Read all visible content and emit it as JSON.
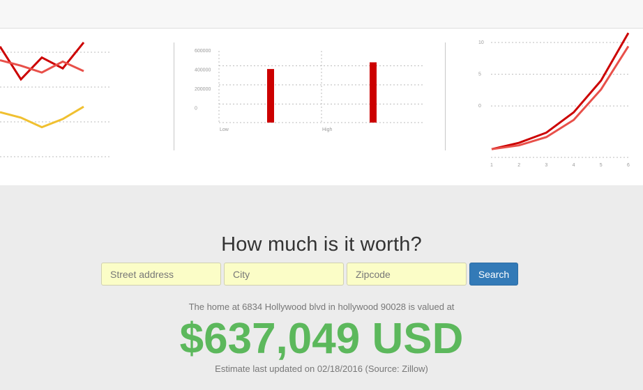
{
  "page": {
    "headline": "How much is it worth?",
    "search": {
      "street_placeholder": "Street address",
      "city_placeholder": "City",
      "zip_placeholder": "Zipcode",
      "button_label": "Search"
    },
    "result": {
      "valued_text": "The home at 6834 Hollywood blvd in hollywood 90028 is valued at",
      "price": "$637,049 USD",
      "updated_text": "Estimate last updated on 02/18/2016 (Source: Zillow)"
    }
  },
  "chart_data": [
    {
      "type": "line",
      "x": [
        1,
        2,
        3,
        4,
        5
      ],
      "ylim": [
        0,
        8
      ],
      "series": [
        {
          "values": [
            7.6,
            5.2,
            6.8,
            6.0,
            7.9
          ],
          "color": "#cc0000"
        },
        {
          "values": [
            6.6,
            6.2,
            5.7,
            6.5,
            5.8
          ],
          "color": "#e8504a"
        },
        {
          "values": [
            2.8,
            2.4,
            1.7,
            2.3,
            3.2
          ],
          "color": "#f0c030"
        }
      ]
    },
    {
      "type": "bar",
      "categories": [
        "Low",
        "High"
      ],
      "values": [
        410000,
        480000
      ],
      "y_ticks": [
        "600000",
        "400000",
        "200000",
        "0"
      ],
      "ylim": [
        -150000,
        600000
      ],
      "color": "#cc0000",
      "grid": true
    },
    {
      "type": "line",
      "x": [
        1,
        2,
        3,
        4,
        5,
        6
      ],
      "x_ticks": [
        "1",
        "2",
        "3",
        "4",
        "5",
        "6"
      ],
      "y_ticks": [
        "10",
        "5",
        "0"
      ],
      "ylim": [
        -7,
        10
      ],
      "series": [
        {
          "values": [
            -6.8,
            -5.8,
            -4.2,
            -1.0,
            4.0,
            11.5
          ],
          "color": "#cc0000"
        },
        {
          "values": [
            -6.8,
            -6.2,
            -4.9,
            -2.2,
            2.6,
            9.4
          ],
          "color": "#e8504a"
        }
      ]
    }
  ]
}
